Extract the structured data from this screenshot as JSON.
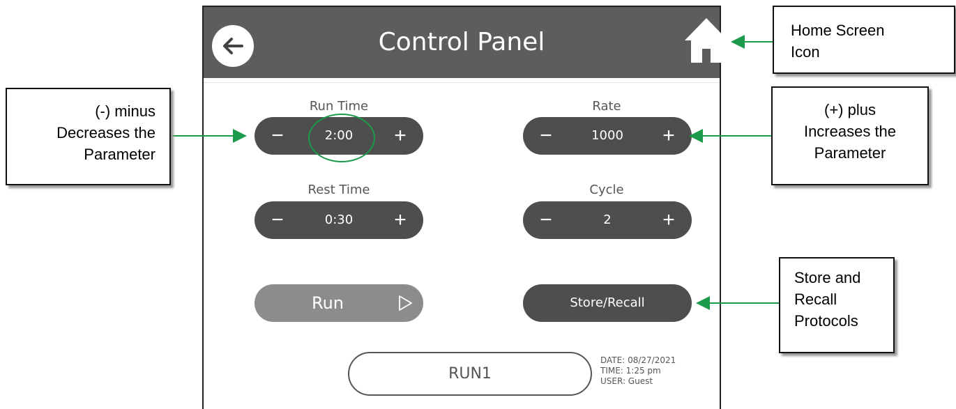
{
  "header": {
    "title": "Control Panel"
  },
  "icons": {
    "back": "arrow-left-icon",
    "home": "home-icon",
    "play": "play-icon"
  },
  "params": {
    "run_time": {
      "label": "Run Time",
      "value": "2:00",
      "minus": "−",
      "plus": "+"
    },
    "rate": {
      "label": "Rate",
      "value": "1000",
      "minus": "−",
      "plus": "+"
    },
    "rest_time": {
      "label": "Rest Time",
      "value": "0:30",
      "minus": "−",
      "plus": "+"
    },
    "cycle": {
      "label": "Cycle",
      "value": "2",
      "minus": "−",
      "plus": "+"
    }
  },
  "actions": {
    "run_label": "Run",
    "store_label": "Store/Recall"
  },
  "protocol": {
    "name": "RUN1"
  },
  "meta": {
    "date": "DATE: 08/27/2021",
    "time": "TIME: 1:25 pm",
    "user": "USER: Guest"
  },
  "callouts": {
    "minus": {
      "line1": "(-) minus",
      "line2": "Decreases the",
      "line3": "Parameter"
    },
    "home": {
      "line1": "Home Screen",
      "line2": "Icon"
    },
    "plus": {
      "line1": "(+) plus",
      "line2": "Increases the",
      "line3": "Parameter"
    },
    "store": {
      "line1": "Store and",
      "line2": "Recall",
      "line3": "Protocols"
    }
  },
  "colors": {
    "header_bg": "#5d5d5d",
    "stepper_bg": "#4e4e4e",
    "run_disabled_bg": "#8c8c8c",
    "annotation_green": "#1a9a4a"
  }
}
